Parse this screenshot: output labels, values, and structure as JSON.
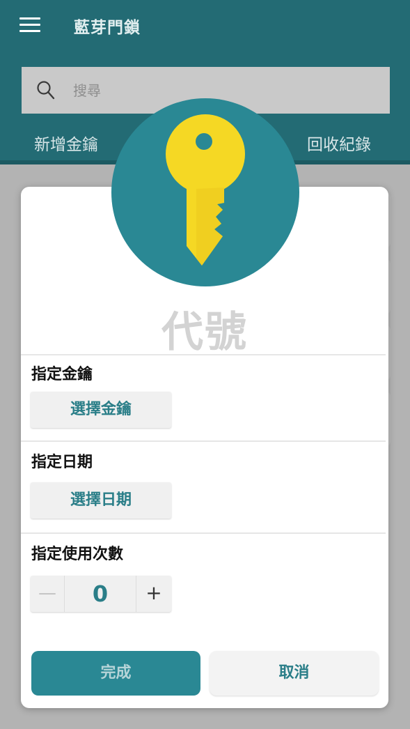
{
  "app": {
    "title": "藍芽門鎖",
    "menu_icon": "hamburger-menu-icon"
  },
  "search": {
    "placeholder": "搜尋",
    "icon": "search-icon"
  },
  "tabs": [
    {
      "label": "新增金鑰"
    },
    {
      "label": "回收紀錄"
    }
  ],
  "dialog": {
    "icon": "key-icon",
    "title": "代號",
    "key_section": {
      "label": "指定金鑰",
      "button": "選擇金鑰"
    },
    "date_section": {
      "label": "指定日期",
      "button": "選擇日期"
    },
    "count_section": {
      "label": "指定使用次數",
      "minus": "—",
      "value": "0",
      "plus": "+"
    },
    "done_button": "完成",
    "cancel_button": "取消"
  },
  "colors": {
    "header_bg": "#236b74",
    "accent": "#2a8894",
    "key_yellow": "#f5d824"
  }
}
